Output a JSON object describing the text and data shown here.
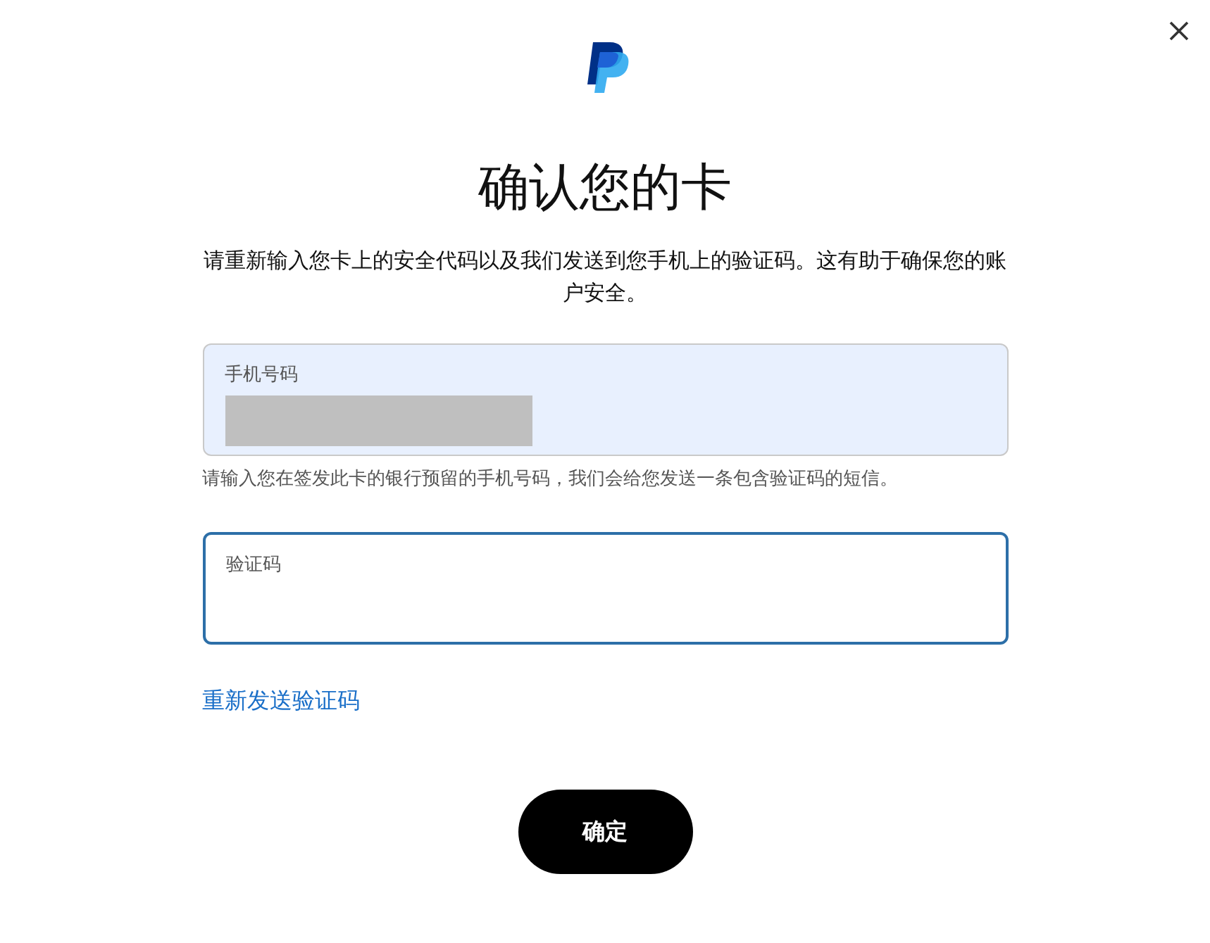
{
  "title": "确认您的卡",
  "description": "请重新输入您卡上的安全代码以及我们发送到您手机上的验证码。这有助于确保您的账户安全。",
  "fields": [
    {
      "label": "手机号码",
      "kind": "redacted",
      "focused": false,
      "autofilled": true,
      "hint": "请输入您在签发此卡的银行预留的手机号码，我们会给您发送一条包含验证码的短信。"
    },
    {
      "label": "验证码",
      "kind": "empty",
      "focused": true,
      "autofilled": false
    }
  ],
  "resend_link": "重新发送验证码",
  "confirm_button": "确定"
}
